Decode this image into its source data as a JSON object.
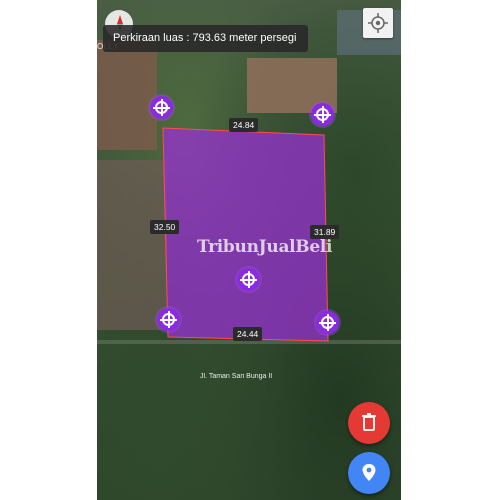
{
  "info": {
    "area_text": "Perkiraan luas : 793.63 meter persegi"
  },
  "map": {
    "corner_label": "OLLY",
    "street_label": "Jl. Taman Sari Bunga II"
  },
  "measurements": {
    "top": "24.84",
    "left": "32.50",
    "right": "31.89",
    "bottom": "24.44"
  },
  "watermark": {
    "text": "TribunJualBeli"
  },
  "colors": {
    "polygon_fill": "#9b2fd6",
    "polygon_edge": "#ff4d4d",
    "marker": "#8a2be2",
    "delete_fab": "#e53935",
    "location_fab": "#4285f4"
  },
  "icons": {
    "compass": "compass-icon",
    "gps": "gps-crosshair-icon",
    "marker": "crosshair-marker-icon",
    "delete": "trash-icon",
    "location": "map-pin-icon"
  }
}
